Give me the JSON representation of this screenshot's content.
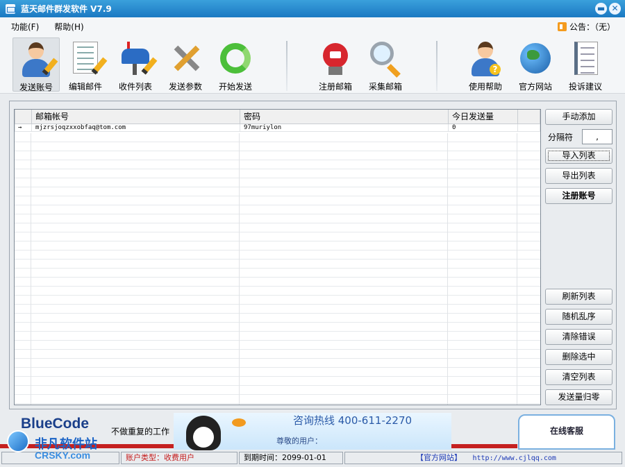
{
  "window": {
    "title": "蓝天邮件群发软件  V7.9",
    "minimize": "▬",
    "close": "✕"
  },
  "menu": {
    "items": [
      "功能(F)",
      "帮助(H)"
    ],
    "notice": "公告：（无）"
  },
  "toolbar": {
    "items": [
      "发送账号",
      "编辑邮件",
      "收件列表",
      "发送参数",
      "开始发送",
      "注册邮箱",
      "采集邮箱",
      "使用帮助",
      "官方网站",
      "投诉建议"
    ]
  },
  "table": {
    "columns": [
      "邮箱帐号",
      "密码",
      "今日发送量"
    ],
    "rows": [
      {
        "indicator": "→",
        "email": "mjzrsjoqzxxobfaq@tom.com",
        "password": "97muriylon",
        "sent_today": "0"
      }
    ]
  },
  "side_buttons": {
    "manual_add": "手动添加",
    "separator_label": "分隔符",
    "separator_value": ",",
    "import_list": "导入列表",
    "export_list": "导出列表",
    "register_account": "注册账号",
    "refresh_list": "刷新列表",
    "shuffle": "随机乱序",
    "clear_errors": "清除错误",
    "delete_selected": "删除选中",
    "clear_list": "清空列表",
    "reset_count": "发送量归零"
  },
  "banner": {
    "brand": "BlueCode",
    "slogan": "不做重复的工作",
    "hotline": "咨询热线 400-611-2270",
    "greeting": "尊敬的用户：",
    "online_service": "在线客服"
  },
  "watermark": {
    "cn": "非凡软件站",
    "en": "CRSKY.com"
  },
  "status": {
    "account_type": "账户类型：收费用户",
    "expiry": "到期时间：2099-01-01",
    "official_site": "【官方网站】",
    "url": "http://www.cjlqq.com"
  }
}
